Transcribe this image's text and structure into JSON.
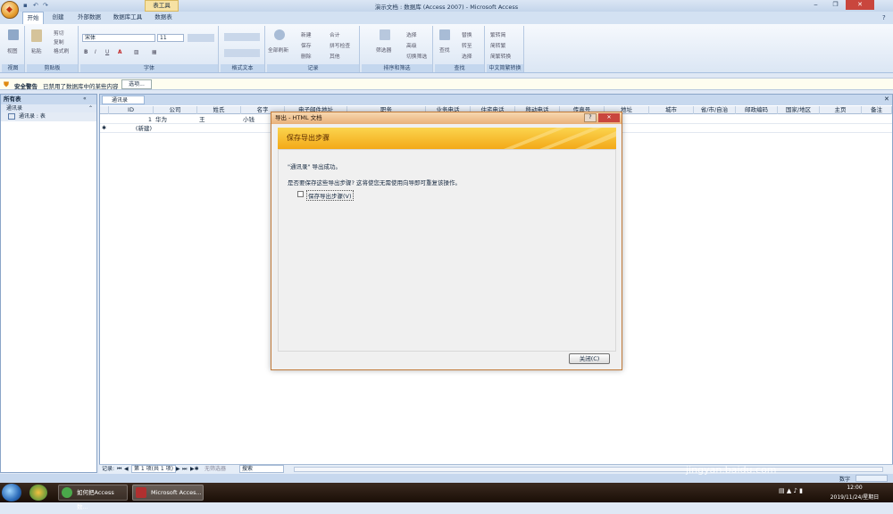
{
  "titlebar": {
    "title": "演示文档 : 数据库 (Access 2007) - Microsoft Access",
    "context_tab": "表工具"
  },
  "tabs": [
    "开始",
    "创建",
    "外部数据",
    "数据库工具",
    "数据表"
  ],
  "ribbon": {
    "view": {
      "label": "视图",
      "group": "视图"
    },
    "clipboard": {
      "paste": "粘贴",
      "cut": "剪切",
      "copy": "复制",
      "format_painter": "格式刷",
      "group": "剪贴板"
    },
    "font": {
      "family": "宋体",
      "size": "11",
      "group": "字体"
    },
    "rich_text": {
      "group": "格式文本"
    },
    "records": {
      "refresh_all": "全部刷新",
      "new": "新建",
      "save": "保存",
      "delete": "删除",
      "totals": "合计",
      "spelling": "拼写检查",
      "more": "其他",
      "group": "记录"
    },
    "sort_filter": {
      "filter": "筛选器",
      "selection": "选择",
      "advanced": "高级",
      "toggle_filter": "切换筛选",
      "group": "排序和筛选"
    },
    "find": {
      "find": "查找",
      "replace": "替换",
      "goto": "转至",
      "select": "选择",
      "group": "查找"
    },
    "chinese_conv": {
      "t2s": "繁转简",
      "s2t": "简转繁",
      "conv": "简繁转换",
      "group": "中文简繁转换"
    }
  },
  "security": {
    "label": "安全警告",
    "message": "已禁用了数据库中的某些内容",
    "options_button": "选项..."
  },
  "nav": {
    "header": "所有表",
    "group": "通讯录",
    "item": "通讯录 : 表"
  },
  "doc_tab": "通讯录",
  "table": {
    "columns": [
      "ID",
      "公司",
      "姓氏",
      "名字",
      "电子邮件地址",
      "职务",
      "业务电话",
      "住宅电话",
      "移动电话",
      "传真号",
      "地址",
      "城市",
      "省/市/自治",
      "邮政编码",
      "国家/地区",
      "主页",
      "备注"
    ],
    "rows": [
      {
        "id": "1",
        "company": "华为",
        "last": "王",
        "first": "小钱"
      },
      {
        "id": "(新建)",
        "company": "",
        "last": "",
        "first": ""
      }
    ]
  },
  "dialog": {
    "title": "导出 - HTML 文档",
    "banner": "保存导出步骤",
    "success": "\"通讯录\" 导出成功。",
    "question": "是否要保存这些导出步骤? 这将使您无需使用向导即可重复该操作。",
    "checkbox": "保存导出步骤(V)",
    "close": "关闭(C)"
  },
  "recnav": {
    "label": "记录:",
    "position": "第 1 项(共 1 项)",
    "filter": "无筛选器",
    "search": "搜索"
  },
  "status": {
    "mode": "数字"
  },
  "taskbar": {
    "items": [
      "如何把Access 数...",
      "Microsoft Acces..."
    ],
    "time": "12:00",
    "date": "2019/11/24/星期日"
  },
  "watermark": {
    "brand": "Baidu经验",
    "url": "jingyan.baidu.com"
  }
}
